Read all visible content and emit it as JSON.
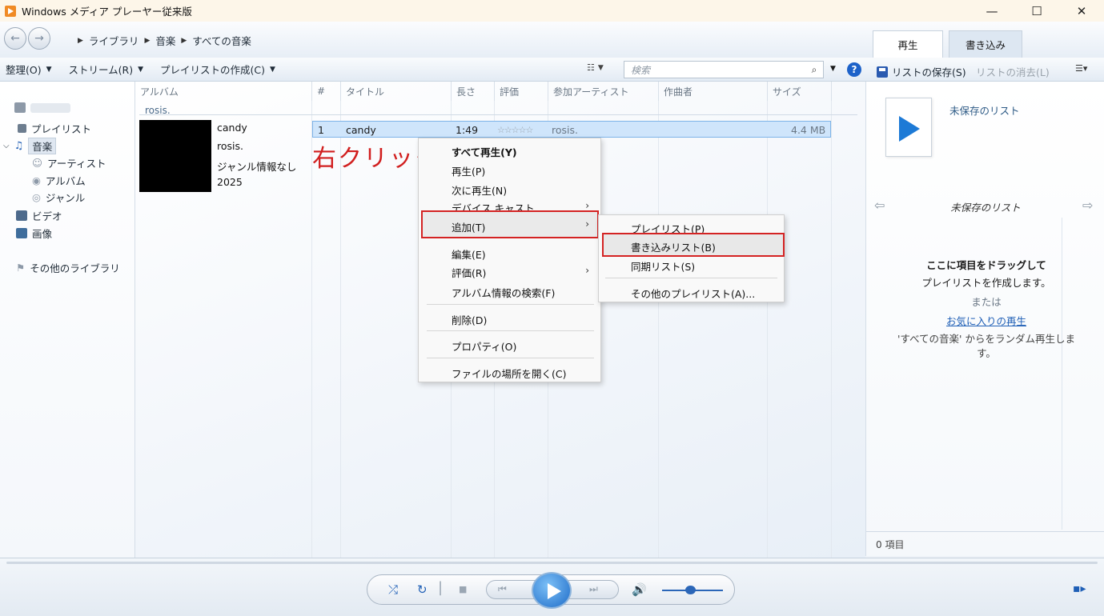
{
  "window": {
    "title": "Windows メディア プレーヤー従来版",
    "minimize": "—",
    "maximize": "☐",
    "close": "✕"
  },
  "breadcrumb": [
    "ライブラリ",
    "音楽",
    "すべての音楽"
  ],
  "tabs": {
    "play": "再生",
    "burn": "書き込み"
  },
  "toolbar": {
    "organize": "整理(O)",
    "stream": "ストリーム(R)",
    "create_playlist": "プレイリストの作成(C)",
    "search_placeholder": "検索"
  },
  "list_toolbar": {
    "save": "リストの保存(S)",
    "clear": "リストの消去(L)"
  },
  "sidebar": {
    "playlist": "プレイリスト",
    "music": "音楽",
    "artist": "アーティスト",
    "album": "アルバム",
    "genre": "ジャンル",
    "video": "ビデオ",
    "picture": "画像",
    "other_libraries": "その他のライブラリ"
  },
  "columns": {
    "album": "アルバム",
    "number": "#",
    "title": "タイトル",
    "length": "長さ",
    "rating": "評価",
    "artist": "参加アーティスト",
    "composer": "作曲者",
    "size": "サイズ"
  },
  "group_label": "rosis.",
  "album_info": [
    "candy",
    "rosis.",
    "ジャンル情報なし",
    "2025"
  ],
  "track": {
    "number": "1",
    "title": "candy",
    "length": "1:49",
    "rating_stars": "☆☆☆☆☆",
    "artist": "rosis.",
    "size": "4.4 MB"
  },
  "annotation": "右クリック",
  "context_menu": {
    "play_all": "すべて再生(Y)",
    "play": "再生(P)",
    "play_next": "次に再生(N)",
    "cast": "デバイス キャスト",
    "add": "追加(T)",
    "edit": "編集(E)",
    "rate": "評価(R)",
    "find_album_info": "アルバム情報の検索(F)",
    "delete": "削除(D)",
    "properties": "プロパティ(O)",
    "open_location": "ファイルの場所を開く(C)"
  },
  "submenu": {
    "playlist": "プレイリスト(P)",
    "burn_list": "書き込みリスト(B)",
    "sync_list": "同期リスト(S)",
    "other_playlist": "その他のプレイリスト(A)..."
  },
  "right_pane": {
    "unsaved_list": "未保存のリスト",
    "unsaved_list_header": "未保存のリスト",
    "drag_here": "ここに項目をドラッグして",
    "create_playlist": "プレイリストを作成します。",
    "or": "または",
    "play_favorites": "お気に入りの再生",
    "random_desc": "'すべての音楽' からをランダム再生しま",
    "random_desc2": "す。",
    "item_count": "0 項目"
  },
  "accent_color": "#1f5fb6",
  "highlight_color": "#d42323"
}
